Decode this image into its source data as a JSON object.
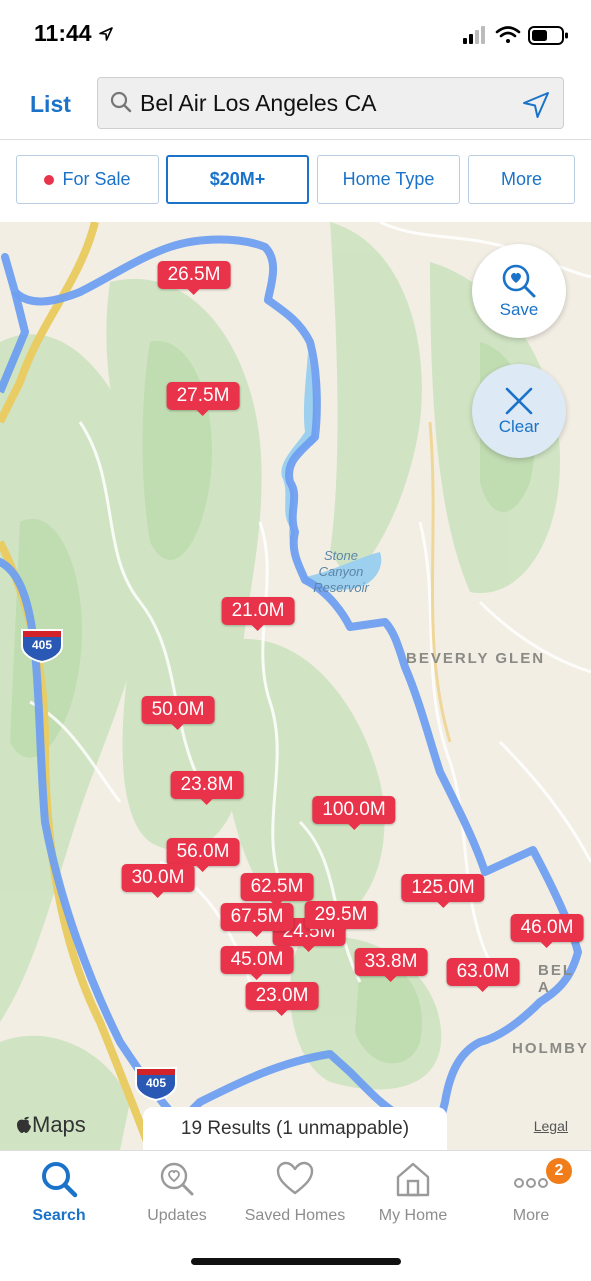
{
  "status_bar": {
    "time": "11:44"
  },
  "header": {
    "list_label": "List",
    "search_value": "Bel Air Los Angeles CA"
  },
  "filters": [
    {
      "label": "For Sale",
      "active": false
    },
    {
      "label": "$20M+",
      "active": true
    },
    {
      "label": "Home Type",
      "active": false
    },
    {
      "label": "More",
      "active": false
    }
  ],
  "map": {
    "save_label": "Save",
    "clear_label": "Clear",
    "area_labels": {
      "beverly_glen": "BEVERLY GLEN",
      "bel_air": "BEL A",
      "holmby": "HOLMBY"
    },
    "reservoir_label": "Stone Canyon Reservoir",
    "interstate": "405",
    "attribution": "Maps",
    "legal": "Legal",
    "results_text": "19 Results (1 unmappable)",
    "pins": [
      {
        "label": "26.5M"
      },
      {
        "label": "27.5M"
      },
      {
        "label": "21.0M"
      },
      {
        "label": "50.0M"
      },
      {
        "label": "23.8M"
      },
      {
        "label": "100.0M"
      },
      {
        "label": "56.0M"
      },
      {
        "label": "30.0M"
      },
      {
        "label": "62.5M"
      },
      {
        "label": "125.0M"
      },
      {
        "label": "24.5M"
      },
      {
        "label": "67.5M"
      },
      {
        "label": "29.5M"
      },
      {
        "label": "46.0M"
      },
      {
        "label": "45.0M"
      },
      {
        "label": "33.8M"
      },
      {
        "label": "63.0M"
      },
      {
        "label": "23.0M"
      }
    ]
  },
  "tabs": [
    {
      "label": "Search",
      "icon": "search-icon",
      "active": true
    },
    {
      "label": "Updates",
      "icon": "updates-icon",
      "active": false
    },
    {
      "label": "Saved Homes",
      "icon": "heart-icon",
      "active": false
    },
    {
      "label": "My Home",
      "icon": "house-icon",
      "active": false
    },
    {
      "label": "More",
      "icon": "more-dots-icon",
      "active": false,
      "badge": "2"
    }
  ],
  "colors": {
    "accent": "#1a73c9",
    "pin": "#e8334a",
    "boundary": "#6f9ff0",
    "badge": "#f07d1a"
  }
}
